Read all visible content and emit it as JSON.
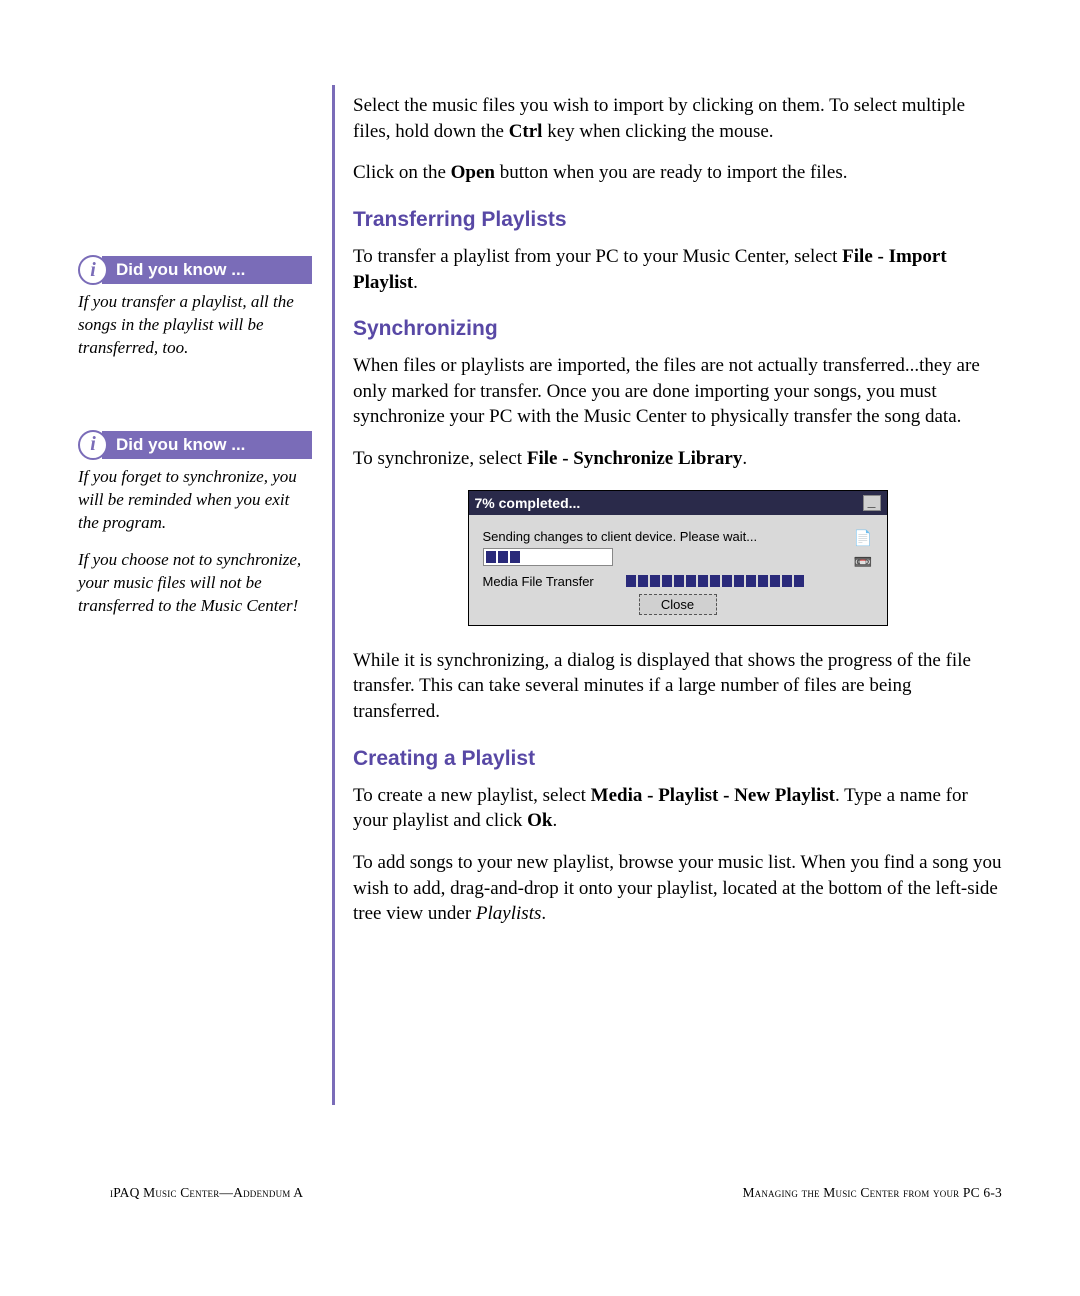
{
  "sidebar": {
    "callouts": [
      {
        "banner": "Did you know ...",
        "paragraphs": [
          "If you transfer a playlist, all the songs in the playlist will be transferred, too."
        ]
      },
      {
        "banner": "Did you know ...",
        "paragraphs": [
          "If you forget to synchronize, you will be reminded when you exit the program.",
          "If you choose not to synchronize, your music files will not be transferred to the Music Center!"
        ]
      }
    ]
  },
  "main": {
    "intro": {
      "p1_a": "Select the music files you wish to import by clicking on them. To select multiple files, hold down the ",
      "p1_bold": "Ctrl",
      "p1_b": " key when clicking the mouse.",
      "p2_a": "Click on the ",
      "p2_bold": "Open",
      "p2_b": " button when you are ready to import the files."
    },
    "sections": {
      "transferring": {
        "heading": "Transferring Playlists",
        "p1_a": "To transfer a playlist from your PC to your Music Center, select ",
        "p1_bold": "File - Import Playlist",
        "p1_b": "."
      },
      "synchronizing": {
        "heading": "Synchronizing",
        "p1": "When files or playlists are imported, the files are not actually transferred...they are only marked for transfer. Once you are done importing your songs, you must synchronize your PC with the Music Center to physically transfer the song data.",
        "p2_a": "To synchronize, select ",
        "p2_bold": "File - Synchronize Library",
        "p2_b": ".",
        "p3": "While it is synchronizing, a dialog is displayed that shows the progress of the file transfer. This can take several minutes if a large number of files are being transferred."
      },
      "creating": {
        "heading": "Creating a Playlist",
        "p1_a": "To create a new playlist, select ",
        "p1_bold": "Media - Playlist - New Playlist",
        "p1_b": ". Type a name for your playlist and click ",
        "p1_bold2": "Ok",
        "p1_c": ".",
        "p2_a": "To add songs to your new playlist, browse your music list. When you find a song you wish to add, drag-and-drop it onto your playlist, located at the bottom of the left-side tree view under ",
        "p2_italic": "Playlists",
        "p2_b": "."
      }
    },
    "dialog": {
      "title": "7% completed...",
      "message": "Sending changes to client device. Please wait...",
      "row_label": "Media File Transfer",
      "close_button": "Close"
    }
  },
  "footer": {
    "left": "iPAQ Music Center—Addendum A",
    "right": "Managing the Music Center from your PC  6-3"
  }
}
